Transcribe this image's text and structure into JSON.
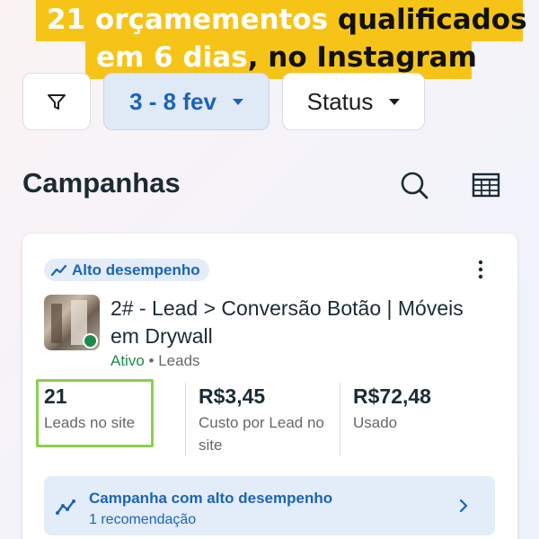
{
  "banner": {
    "line1_part1": "21 orçamementos ",
    "line1_part2": "qualificados",
    "line2_part1": "em ",
    "line2_part2": "6 dias",
    "line2_part3": ", no Instagram"
  },
  "filters": {
    "date_label": "3 - 8 fev",
    "status_label": "Status"
  },
  "section": {
    "title": "Campanhas"
  },
  "campaign": {
    "badge": "Alto desempenho",
    "title": "2# - Lead > Conversão Botão | Móveis em Drywall",
    "status": "Ativo",
    "separator": "•",
    "objective": "Leads",
    "metrics": [
      {
        "value": "21",
        "label": "Leads no site"
      },
      {
        "value": "R$3,45",
        "label": "Custo por Lead no site"
      },
      {
        "value": "R$72,48",
        "label": "Usado"
      }
    ],
    "recommendation": {
      "title": "Campanha com alto desempenho",
      "subtitle": "1 recomendação"
    }
  },
  "colors": {
    "banner_bg": "#f6c417",
    "accent_blue": "#1d63b5",
    "active_green": "#1f8a4c",
    "highlight_box": "#8ad14c"
  },
  "icons": [
    "filter-icon",
    "chevron-down-icon",
    "search-icon",
    "table-icon",
    "trend-icon",
    "more-icon",
    "chevron-right-icon"
  ]
}
